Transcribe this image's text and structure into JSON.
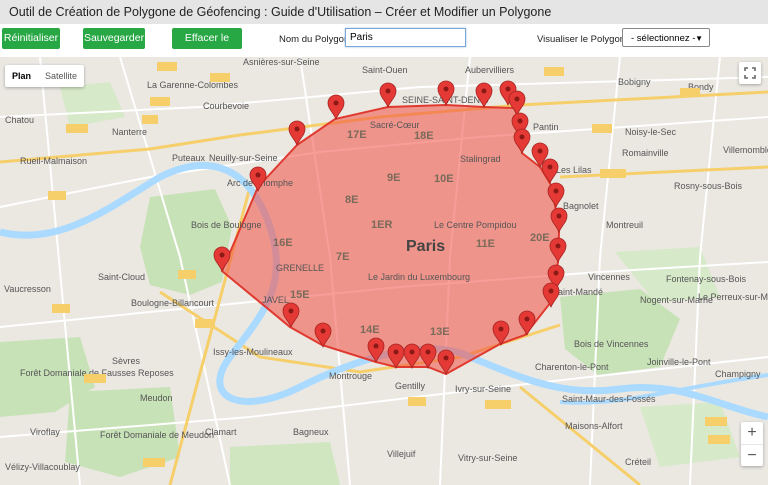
{
  "title": "Outil de Création de Polygone de Géofencing : Guide d'Utilisation – Créer et Modifier un Polygone",
  "toolbar": {
    "reset_label": "Réinitialiser",
    "save_label": "Sauvegarder",
    "erase_label": "Effacer le Point",
    "name_label": "Nom du Polygone:",
    "name_value": "Paris",
    "view_label": "Visualiser le Polygone:",
    "select_value": "- sélectionnez -"
  },
  "map": {
    "type_plan": "Plan",
    "type_satellite": "Satellite",
    "city_label": "Paris",
    "zoom_in": "+",
    "zoom_out": "−",
    "polygon_fill": "#f24e43",
    "marker_color": "#e53935",
    "places": [
      {
        "text": "Asnières-sur-Seine"
      },
      {
        "text": "Aubervilliers"
      },
      {
        "text": "Saint-Ouen"
      },
      {
        "text": "Bobigny"
      },
      {
        "text": "Bondy"
      },
      {
        "text": "La Garenne-Colombes"
      },
      {
        "text": "Courbevoie"
      },
      {
        "text": "Pantin"
      },
      {
        "text": "Noisy-le-Sec"
      },
      {
        "text": "Chatou"
      },
      {
        "text": "Nanterre"
      },
      {
        "text": "Romainville"
      },
      {
        "text": "Villemomble"
      },
      {
        "text": "Rueil-Malmaison"
      },
      {
        "text": "Puteaux"
      },
      {
        "text": "Neuilly-sur-Seine"
      },
      {
        "text": "Les Lilas"
      },
      {
        "text": "Rosny-sous-Bois"
      },
      {
        "text": "Bagnolet"
      },
      {
        "text": "Montreuil"
      },
      {
        "text": "Bois de Boulogne"
      },
      {
        "text": "Saint-Cloud"
      },
      {
        "text": "Vincennes"
      },
      {
        "text": "Fontenay-sous-Bois"
      },
      {
        "text": "Vaucresson"
      },
      {
        "text": "Boulogne-Billancourt"
      },
      {
        "text": "Saint-Mandé"
      },
      {
        "text": "Nogent-sur-Marne"
      },
      {
        "text": "Le Perreux-sur-Marne"
      },
      {
        "text": "Issy-les-Moulineaux"
      },
      {
        "text": "Bois de Vincennes"
      },
      {
        "text": "Sèvres"
      },
      {
        "text": "Charenton-le-Pont"
      },
      {
        "text": "Joinville-le-Pont"
      },
      {
        "text": "Forêt Domaniale de Fausses Reposes"
      },
      {
        "text": "Meudon"
      },
      {
        "text": "Montrouge"
      },
      {
        "text": "Gentilly"
      },
      {
        "text": "Ivry-sur-Seine"
      },
      {
        "text": "Saint-Maur-des-Fossés"
      },
      {
        "text": "Champigny"
      },
      {
        "text": "Viroflay"
      },
      {
        "text": "Clamart"
      },
      {
        "text": "Bagneux"
      },
      {
        "text": "Maisons-Alfort"
      },
      {
        "text": "Forêt Domaniale de Meudon"
      },
      {
        "text": "Vélizy-Villacoublay"
      },
      {
        "text": "Villejuif"
      },
      {
        "text": "Vitry-sur-Seine"
      },
      {
        "text": "Créteil"
      },
      {
        "text": "Sacré-Cœur"
      },
      {
        "text": "Stalingrad"
      },
      {
        "text": "Arc de Triomphe"
      },
      {
        "text": "Le Centre Pompidou"
      },
      {
        "text": "Le Jardin du Luxembourg"
      },
      {
        "text": "GRENELLE"
      },
      {
        "text": "JAVEL"
      },
      {
        "text": "SEINE-SAINT-DENIS"
      }
    ],
    "arrondissements": [
      "17E",
      "18E",
      "9E",
      "10E",
      "8E",
      "1ER",
      "16E",
      "7E",
      "11E",
      "20E",
      "15E",
      "14E",
      "13E"
    ]
  }
}
